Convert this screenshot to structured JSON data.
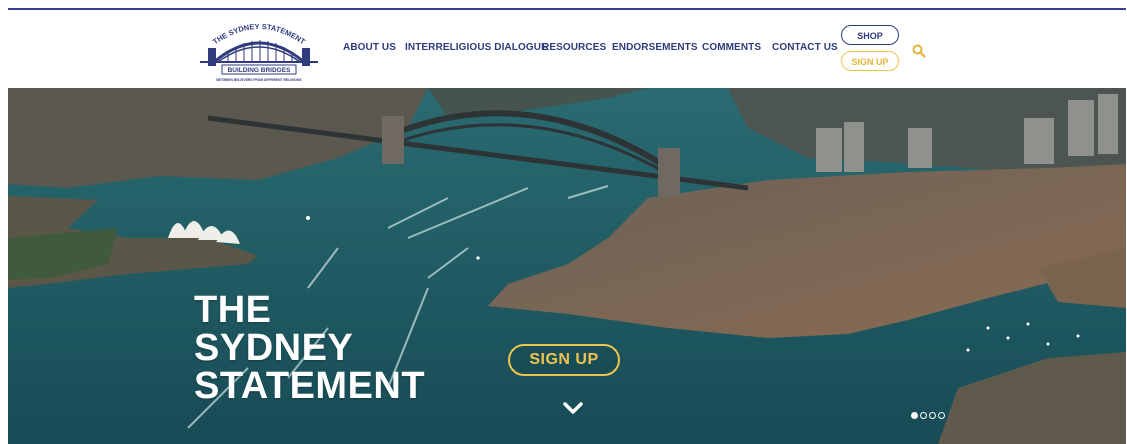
{
  "logo": {
    "top_text": "THE SYDNEY STATEMENT",
    "banner_text": "BUILDING BRIDGES",
    "tagline": "BETWEEN BELIEVERS FROM DIFFERENT RELIGIONS"
  },
  "nav": {
    "items": [
      {
        "label": "ABOUT US"
      },
      {
        "label": "INTERRELIGIOUS DIALOGUE"
      },
      {
        "label": "RESOURCES"
      },
      {
        "label": "ENDORSEMENTS"
      },
      {
        "label": "COMMENTS"
      },
      {
        "label": "CONTACT US"
      }
    ],
    "shop_label": "SHOP",
    "signup_label": "SIGN UP",
    "search_icon": "search-icon"
  },
  "hero": {
    "title_lines": [
      "THE",
      "SYDNEY",
      "STATEMENT"
    ],
    "signup_label": "SIGN UP",
    "scroll_icon": "chevron-down-icon",
    "slides_total": 4,
    "active_slide": 1
  },
  "colors": {
    "navy": "#2f3b7c",
    "gold": "#f0c24f",
    "water": "#1f5e66"
  }
}
